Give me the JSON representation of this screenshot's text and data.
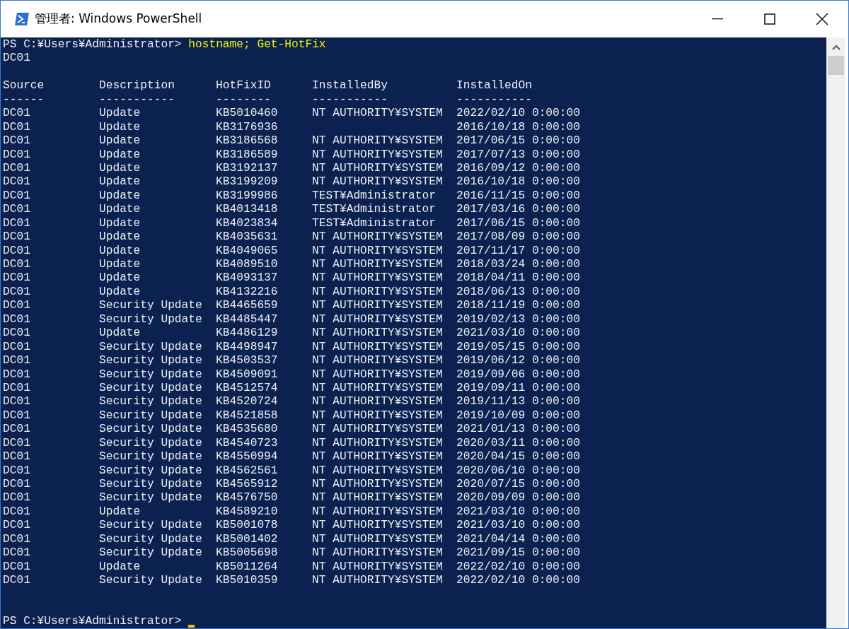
{
  "window": {
    "title": "管理者: Windows PowerShell"
  },
  "console": {
    "prompt": "PS C:¥Users¥Administrator>",
    "command": "hostname; Get-HotFix",
    "output_lines": [
      "DC01"
    ],
    "columns": [
      {
        "header": "Source",
        "rule": "------"
      },
      {
        "header": "Description",
        "rule": "-----------"
      },
      {
        "header": "HotFixID",
        "rule": "--------"
      },
      {
        "header": "InstalledBy",
        "rule": "-----------"
      },
      {
        "header": "InstalledOn",
        "rule": "-----------"
      }
    ],
    "rows": [
      {
        "source": "DC01",
        "description": "Update",
        "hotfix_id": "KB5010460",
        "installed_by": "NT AUTHORITY¥SYSTEM",
        "installed_on": "2022/02/10 0:00:00"
      },
      {
        "source": "DC01",
        "description": "Update",
        "hotfix_id": "KB3176936",
        "installed_on": "2016/10/18 0:00:00"
      },
      {
        "source": "DC01",
        "description": "Update",
        "hotfix_id": "KB3186568",
        "installed_by": "NT AUTHORITY¥SYSTEM",
        "installed_on": "2017/06/15 0:00:00"
      },
      {
        "source": "DC01",
        "description": "Update",
        "hotfix_id": "KB3186589",
        "installed_by": "NT AUTHORITY¥SYSTEM",
        "installed_on": "2017/07/13 0:00:00"
      },
      {
        "source": "DC01",
        "description": "Update",
        "hotfix_id": "KB3192137",
        "installed_by": "NT AUTHORITY¥SYSTEM",
        "installed_on": "2016/09/12 0:00:00"
      },
      {
        "source": "DC01",
        "description": "Update",
        "hotfix_id": "KB3199209",
        "installed_by": "NT AUTHORITY¥SYSTEM",
        "installed_on": "2016/10/18 0:00:00"
      },
      {
        "source": "DC01",
        "description": "Update",
        "hotfix_id": "KB3199986",
        "installed_by": "TEST¥Administrator",
        "installed_on": "2016/11/15 0:00:00"
      },
      {
        "source": "DC01",
        "description": "Update",
        "hotfix_id": "KB4013418",
        "installed_by": "TEST¥Administrator",
        "installed_on": "2017/03/16 0:00:00"
      },
      {
        "source": "DC01",
        "description": "Update",
        "hotfix_id": "KB4023834",
        "installed_by": "TEST¥Administrator",
        "installed_on": "2017/06/15 0:00:00"
      },
      {
        "source": "DC01",
        "description": "Update",
        "hotfix_id": "KB4035631",
        "installed_by": "NT AUTHORITY¥SYSTEM",
        "installed_on": "2017/08/09 0:00:00"
      },
      {
        "source": "DC01",
        "description": "Update",
        "hotfix_id": "KB4049065",
        "installed_by": "NT AUTHORITY¥SYSTEM",
        "installed_on": "2017/11/17 0:00:00"
      },
      {
        "source": "DC01",
        "description": "Update",
        "hotfix_id": "KB4089510",
        "installed_by": "NT AUTHORITY¥SYSTEM",
        "installed_on": "2018/03/24 0:00:00"
      },
      {
        "source": "DC01",
        "description": "Update",
        "hotfix_id": "KB4093137",
        "installed_by": "NT AUTHORITY¥SYSTEM",
        "installed_on": "2018/04/11 0:00:00"
      },
      {
        "source": "DC01",
        "description": "Update",
        "hotfix_id": "KB4132216",
        "installed_by": "NT AUTHORITY¥SYSTEM",
        "installed_on": "2018/06/13 0:00:00"
      },
      {
        "source": "DC01",
        "description": "Security Update",
        "hotfix_id": "KB4465659",
        "installed_by": "NT AUTHORITY¥SYSTEM",
        "installed_on": "2018/11/19 0:00:00"
      },
      {
        "source": "DC01",
        "description": "Security Update",
        "hotfix_id": "KB4485447",
        "installed_by": "NT AUTHORITY¥SYSTEM",
        "installed_on": "2019/02/13 0:00:00"
      },
      {
        "source": "DC01",
        "description": "Update",
        "hotfix_id": "KB4486129",
        "installed_by": "NT AUTHORITY¥SYSTEM",
        "installed_on": "2021/03/10 0:00:00"
      },
      {
        "source": "DC01",
        "description": "Security Update",
        "hotfix_id": "KB4498947",
        "installed_by": "NT AUTHORITY¥SYSTEM",
        "installed_on": "2019/05/15 0:00:00"
      },
      {
        "source": "DC01",
        "description": "Security Update",
        "hotfix_id": "KB4503537",
        "installed_by": "NT AUTHORITY¥SYSTEM",
        "installed_on": "2019/06/12 0:00:00"
      },
      {
        "source": "DC01",
        "description": "Security Update",
        "hotfix_id": "KB4509091",
        "installed_by": "NT AUTHORITY¥SYSTEM",
        "installed_on": "2019/09/06 0:00:00"
      },
      {
        "source": "DC01",
        "description": "Security Update",
        "hotfix_id": "KB4512574",
        "installed_by": "NT AUTHORITY¥SYSTEM",
        "installed_on": "2019/09/11 0:00:00"
      },
      {
        "source": "DC01",
        "description": "Security Update",
        "hotfix_id": "KB4520724",
        "installed_by": "NT AUTHORITY¥SYSTEM",
        "installed_on": "2019/11/13 0:00:00"
      },
      {
        "source": "DC01",
        "description": "Security Update",
        "hotfix_id": "KB4521858",
        "installed_by": "NT AUTHORITY¥SYSTEM",
        "installed_on": "2019/10/09 0:00:00"
      },
      {
        "source": "DC01",
        "description": "Security Update",
        "hotfix_id": "KB4535680",
        "installed_by": "NT AUTHORITY¥SYSTEM",
        "installed_on": "2021/01/13 0:00:00"
      },
      {
        "source": "DC01",
        "description": "Security Update",
        "hotfix_id": "KB4540723",
        "installed_by": "NT AUTHORITY¥SYSTEM",
        "installed_on": "2020/03/11 0:00:00"
      },
      {
        "source": "DC01",
        "description": "Security Update",
        "hotfix_id": "KB4550994",
        "installed_by": "NT AUTHORITY¥SYSTEM",
        "installed_on": "2020/04/15 0:00:00"
      },
      {
        "source": "DC01",
        "description": "Security Update",
        "hotfix_id": "KB4562561",
        "installed_by": "NT AUTHORITY¥SYSTEM",
        "installed_on": "2020/06/10 0:00:00"
      },
      {
        "source": "DC01",
        "description": "Security Update",
        "hotfix_id": "KB4565912",
        "installed_by": "NT AUTHORITY¥SYSTEM",
        "installed_on": "2020/07/15 0:00:00"
      },
      {
        "source": "DC01",
        "description": "Security Update",
        "hotfix_id": "KB4576750",
        "installed_by": "NT AUTHORITY¥SYSTEM",
        "installed_on": "2020/09/09 0:00:00"
      },
      {
        "source": "DC01",
        "description": "Update",
        "hotfix_id": "KB4589210",
        "installed_by": "NT AUTHORITY¥SYSTEM",
        "installed_on": "2021/03/10 0:00:00"
      },
      {
        "source": "DC01",
        "description": "Security Update",
        "hotfix_id": "KB5001078",
        "installed_by": "NT AUTHORITY¥SYSTEM",
        "installed_on": "2021/03/10 0:00:00"
      },
      {
        "source": "DC01",
        "description": "Security Update",
        "hotfix_id": "KB5001402",
        "installed_by": "NT AUTHORITY¥SYSTEM",
        "installed_on": "2021/04/14 0:00:00"
      },
      {
        "source": "DC01",
        "description": "Security Update",
        "hotfix_id": "KB5005698",
        "installed_by": "NT AUTHORITY¥SYSTEM",
        "installed_on": "2021/09/15 0:00:00"
      },
      {
        "source": "DC01",
        "description": "Update",
        "hotfix_id": "KB5011264",
        "installed_by": "NT AUTHORITY¥SYSTEM",
        "installed_on": "2022/02/10 0:00:00"
      },
      {
        "source": "DC01",
        "description": "Security Update",
        "hotfix_id": "KB5010359",
        "installed_by": "NT AUTHORITY¥SYSTEM",
        "installed_on": "2022/02/10 0:00:00"
      }
    ],
    "final_prompt": "PS C:¥Users¥Administrator>"
  }
}
